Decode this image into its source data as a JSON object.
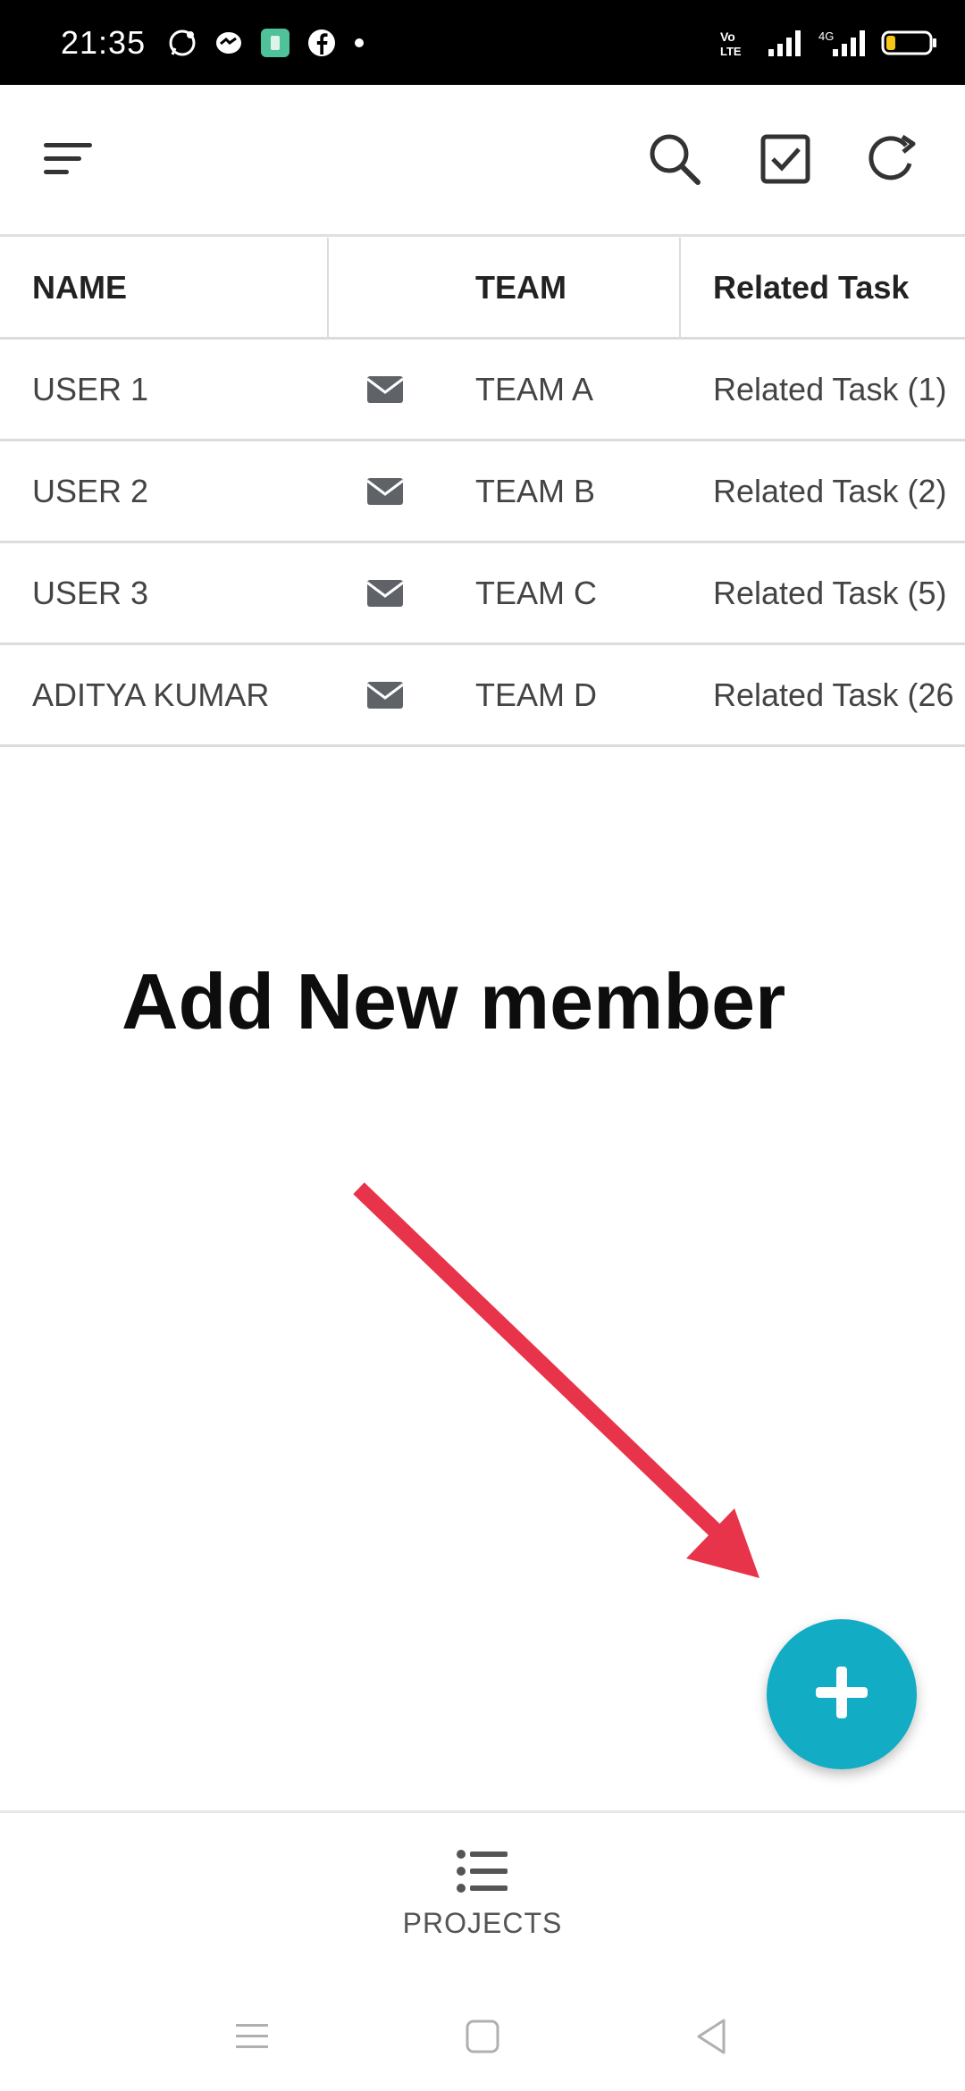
{
  "status_bar": {
    "time": "21:35",
    "left_icons": [
      "whatsapp-icon",
      "messenger-icon",
      "app-icon",
      "facebook-icon",
      "dot-icon"
    ],
    "right_icons": [
      "volte-icon",
      "signal-icon",
      "4g-signal-icon",
      "battery-icon"
    ],
    "volte_label": "VoLTE",
    "network_label": "4G"
  },
  "toolbar": {
    "icons": [
      "menu-icon",
      "search-icon",
      "checkbox-icon",
      "refresh-icon"
    ]
  },
  "table": {
    "headers": {
      "name": "NAME",
      "email": "",
      "team": "TEAM",
      "related_task": "Related Task"
    },
    "rows": [
      {
        "name": "USER 1",
        "team": "TEAM A",
        "related_task": "Related Task (1)"
      },
      {
        "name": "USER 2",
        "team": "TEAM B",
        "related_task": "Related Task (2)"
      },
      {
        "name": "USER 3",
        "team": "TEAM C",
        "related_task": "Related Task (5)"
      },
      {
        "name": "ADITYA KUMAR",
        "team": "TEAM D",
        "related_task": "Related Task (26"
      }
    ]
  },
  "annotation": {
    "text": "Add New member",
    "arrow_color": "#e8344a"
  },
  "fab": {
    "icon": "plus-icon",
    "color": "#12acc4"
  },
  "bottom_nav": {
    "projects_label": "PROJECTS",
    "projects_icon": "list-icon"
  },
  "system_nav": {
    "icons": [
      "recents-icon",
      "home-icon",
      "back-icon"
    ]
  }
}
